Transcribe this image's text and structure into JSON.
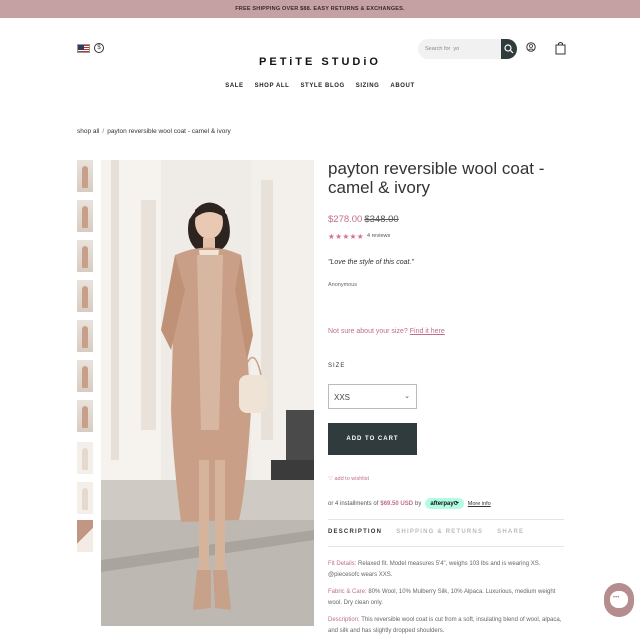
{
  "announcement": "FREE SHIPPING OVER $88. EASY RETURNS & EXCHANGES.",
  "header": {
    "currency_symbol": "$",
    "logo": "PETiTE STUDiO",
    "search_placeholder": "Search for  yo",
    "icons": [
      "us-flag-icon",
      "currency-icon",
      "search-icon",
      "account-icon",
      "bag-icon"
    ]
  },
  "nav": [
    "SALE",
    "SHOP ALL",
    "STYLE BLOG",
    "SIZING",
    "ABOUT"
  ],
  "breadcrumb": {
    "parent": "shop all",
    "separator": "/",
    "current": "payton reversible wool coat - camel & ivory"
  },
  "product": {
    "title": "payton reversible wool coat - camel & ivory",
    "price": "$278.00",
    "compare_price": "$348.00",
    "stars": "★★★★★",
    "rating": 5,
    "reviews": "4 reviews",
    "quote": "\"Love the style of this coat.\"",
    "author": "Anonymous",
    "size_hint": "Not sure about your size?",
    "size_hint_link": "Find it here",
    "size_label": "SIZE",
    "size_value": "XXS",
    "add_to_cart": "ADD TO CART",
    "wishlist": "♡ add to wishlist",
    "installments_prefix": "or 4 installments of",
    "installments_amount": "$69.50 USD",
    "installments_by": "by",
    "afterpay": "afterpay⟳",
    "more_info": "More info"
  },
  "tabs": [
    "DESCRIPTION",
    "SHIPPING & RETURNS",
    "SHARE"
  ],
  "description": {
    "fit_label": "Fit Details:",
    "fit_text": " Relaxed fit. Model measures 5'4\", weighs 103 lbs and is wearing XS. @piecesofc wears XXS.",
    "fabric_label": "Fabric & Care:",
    "fabric_text": " 80% Wool, 10% Mulberry Silk, 10% Alpaca. Luxurious, medium weight wool. Dry clean only.",
    "desc_label": "Description:",
    "desc_text": " This reversible wool coat is cut from a soft, insulating blend of wool, alpaca, and silk and has slightly dropped shoulders."
  },
  "colors": {
    "announce_bg": "#c6a1a3",
    "accent_pink": "#c06f86",
    "button_dark": "#2f3b3c",
    "afterpay_mint": "#b2fce4"
  }
}
